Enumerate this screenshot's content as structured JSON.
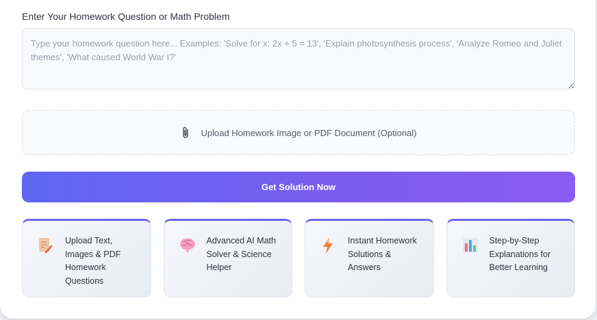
{
  "form": {
    "question_label": "Enter Your Homework Question or Math Problem",
    "question_placeholder": "Type your homework question here... Examples: 'Solve for x: 2x + 5 = 13', 'Explain photosynthesis process', 'Analyze Romeo and Juliet themes', 'What caused World War I?'",
    "question_value": "",
    "upload_icon": "paperclip-icon",
    "upload_label": "Upload Homework Image or PDF Document (Optional)",
    "submit_label": "Get Solution Now"
  },
  "features": [
    {
      "icon": "document-pencil-icon",
      "label": "Upload Text, Images & PDF Homework Questions"
    },
    {
      "icon": "brain-icon",
      "label": "Advanced AI Math Solver & Science Helper"
    },
    {
      "icon": "lightning-icon",
      "label": "Instant Homework Solutions & Answers"
    },
    {
      "icon": "bar-chart-icon",
      "label": "Step-by-Step Explanations for Better Learning"
    }
  ],
  "colors": {
    "accent_start": "#5f67f2",
    "accent_end": "#8a5cf3",
    "card_top_border": "#6d63ee"
  }
}
